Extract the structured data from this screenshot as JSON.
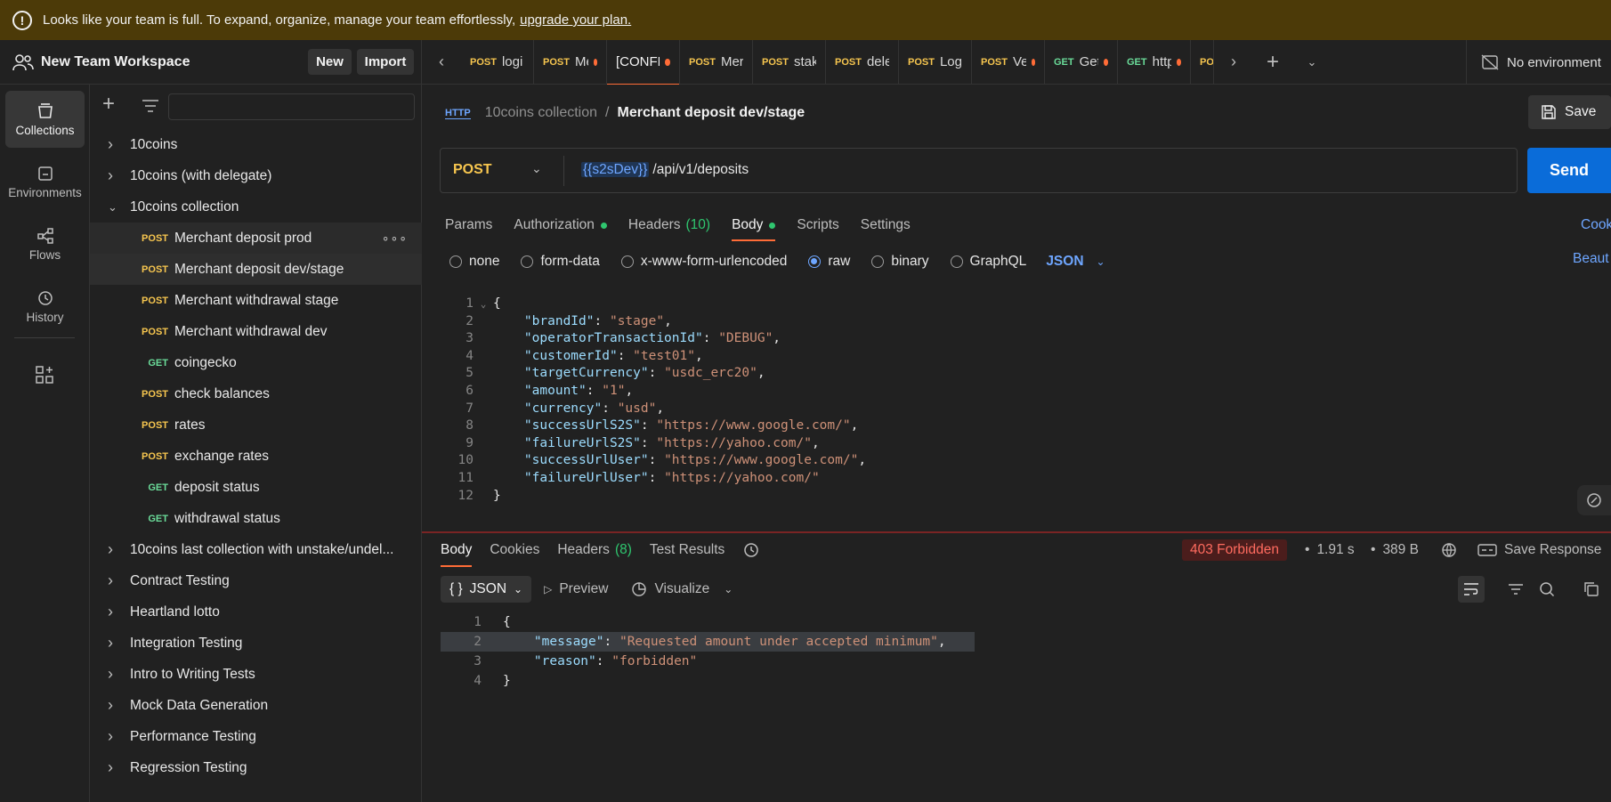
{
  "banner": {
    "text": "Looks like your team is full. To expand, organize, manage your team effortlessly,",
    "link": "upgrade your plan."
  },
  "workspace": {
    "name": "New Team Workspace",
    "new_label": "New",
    "import_label": "Import"
  },
  "rail": [
    {
      "label": "Collections",
      "icon": "collections-icon"
    },
    {
      "label": "Environments",
      "icon": "environments-icon"
    },
    {
      "label": "Flows",
      "icon": "flows-icon"
    },
    {
      "label": "History",
      "icon": "history-icon"
    }
  ],
  "tree": [
    {
      "type": "folder",
      "label": "10coins",
      "expanded": false
    },
    {
      "type": "folder",
      "label": "10coins (with delegate)",
      "expanded": false
    },
    {
      "type": "folder",
      "label": "10coins collection",
      "expanded": true
    },
    {
      "type": "request",
      "method": "POST",
      "label": "Merchant deposit prod",
      "state": "hover"
    },
    {
      "type": "request",
      "method": "POST",
      "label": "Merchant deposit dev/stage",
      "state": "selected"
    },
    {
      "type": "request",
      "method": "POST",
      "label": "Merchant withdrawal stage"
    },
    {
      "type": "request",
      "method": "POST",
      "label": "Merchant withdrawal dev"
    },
    {
      "type": "request",
      "method": "GET",
      "label": "coingecko"
    },
    {
      "type": "request",
      "method": "POST",
      "label": "check balances"
    },
    {
      "type": "request",
      "method": "POST",
      "label": "rates"
    },
    {
      "type": "request",
      "method": "POST",
      "label": "exchange rates"
    },
    {
      "type": "request",
      "method": "GET",
      "label": "deposit status"
    },
    {
      "type": "request",
      "method": "GET",
      "label": "withdrawal status"
    },
    {
      "type": "folder",
      "label": "10coins last collection with unstake/undel...",
      "expanded": false
    },
    {
      "type": "folder",
      "label": "Contract Testing",
      "expanded": false
    },
    {
      "type": "folder",
      "label": "Heartland lotto",
      "expanded": false
    },
    {
      "type": "folder",
      "label": "Integration Testing",
      "expanded": false
    },
    {
      "type": "folder",
      "label": "Intro to Writing Tests",
      "expanded": false
    },
    {
      "type": "folder",
      "label": "Mock Data Generation",
      "expanded": false
    },
    {
      "type": "folder",
      "label": "Performance Testing",
      "expanded": false
    },
    {
      "type": "folder",
      "label": "Regression Testing",
      "expanded": false
    }
  ],
  "tabs": [
    {
      "method": "POST",
      "label": "logi",
      "dot": false
    },
    {
      "method": "POST",
      "label": "Mer",
      "dot": true
    },
    {
      "method": "",
      "label": "[CONFLIC",
      "dot": true,
      "active": true
    },
    {
      "method": "POST",
      "label": "Mer",
      "dot": false
    },
    {
      "method": "POST",
      "label": "stak",
      "dot": false
    },
    {
      "method": "POST",
      "label": "dele",
      "dot": false
    },
    {
      "method": "POST",
      "label": "Log",
      "dot": false
    },
    {
      "method": "POST",
      "label": "Veri",
      "dot": true
    },
    {
      "method": "GET",
      "label": "Get l",
      "dot": true
    },
    {
      "method": "GET",
      "label": "https",
      "dot": true
    },
    {
      "method": "POS",
      "label": "",
      "dot": false
    }
  ],
  "environment": {
    "label": "No environment"
  },
  "breadcrumb": {
    "http": "HTTP",
    "parent": "10coins collection",
    "current": "Merchant deposit dev/stage"
  },
  "save_label": "Save",
  "request": {
    "method": "POST",
    "url_var": "{{s2sDev}}",
    "url_path": "/api/v1/deposits",
    "send_label": "Send"
  },
  "request_tabs": {
    "params": "Params",
    "authorization": "Authorization",
    "headers": "Headers",
    "headers_count": "(10)",
    "body": "Body",
    "scripts": "Scripts",
    "settings": "Settings",
    "cookies": "Cook"
  },
  "body_types": {
    "none": "none",
    "form_data": "form-data",
    "urlencoded": "x-www-form-urlencoded",
    "raw": "raw",
    "binary": "binary",
    "graphql": "GraphQL",
    "format": "JSON",
    "beautify": "Beaut"
  },
  "request_body": {
    "line_numbers": [
      "1",
      "2",
      "3",
      "4",
      "5",
      "6",
      "7",
      "8",
      "9",
      "10",
      "11",
      "12"
    ],
    "open": "{",
    "close": "}",
    "fields": [
      {
        "key": "\"brandId\"",
        "value": "\"stage\"",
        "comma": ","
      },
      {
        "key": "\"operatorTransactionId\"",
        "value": "\"DEBUG\"",
        "comma": ","
      },
      {
        "key": "\"customerId\"",
        "value": "\"test01\"",
        "comma": ","
      },
      {
        "key": "\"targetCurrency\"",
        "value": "\"usdc_erc20\"",
        "comma": ","
      },
      {
        "key": "\"amount\"",
        "value": "\"1\"",
        "comma": ","
      },
      {
        "key": "\"currency\"",
        "value": "\"usd\"",
        "comma": ","
      },
      {
        "key": "\"successUrlS2S\"",
        "value": "\"https://www.google.com/\"",
        "comma": ","
      },
      {
        "key": "\"failureUrlS2S\"",
        "value": "\"https://yahoo.com/\"",
        "comma": ","
      },
      {
        "key": "\"successUrlUser\"",
        "value": "\"https://www.google.com/\"",
        "comma": ","
      },
      {
        "key": "\"failureUrlUser\"",
        "value": "\"https://yahoo.com/\"",
        "comma": ""
      }
    ]
  },
  "response_tabs": {
    "body": "Body",
    "cookies": "Cookies",
    "headers": "Headers",
    "headers_count": "(8)",
    "test_results": "Test Results"
  },
  "response_meta": {
    "status": "403 Forbidden",
    "time": "1.91 s",
    "size": "389 B",
    "save_response": "Save Response"
  },
  "response_toolbar": {
    "format": "JSON",
    "preview": "Preview",
    "visualize": "Visualize"
  },
  "response_body": {
    "line_numbers": [
      "1",
      "2",
      "3",
      "4"
    ],
    "open": "{",
    "close": "}",
    "message_key": "\"message\"",
    "message_value": "\"Requested amount under accepted minimum\"",
    "reason_key": "\"reason\"",
    "reason_value": "\"forbidden\""
  },
  "colors": {
    "accent": "#ff6c37",
    "post": "#f7c64f",
    "get": "#6bdd9a",
    "link": "#6ea6ff",
    "send": "#0a6cd9",
    "error": "#ff6b5f"
  }
}
